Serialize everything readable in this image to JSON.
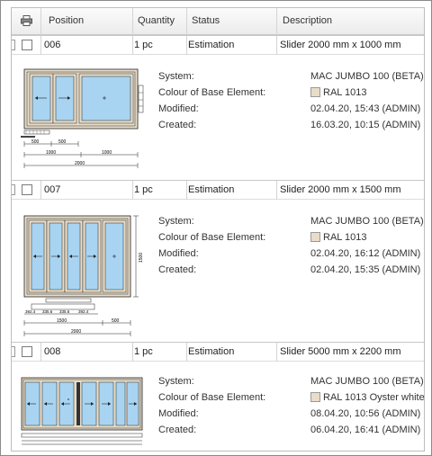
{
  "header": {
    "printer_icon": "printer-icon",
    "position": "Position",
    "quantity": "Quantity",
    "status": "Status",
    "description": "Description"
  },
  "labels": {
    "system": "System:",
    "colour": "Colour of Base Element:",
    "modified": "Modified:",
    "created": "Created:"
  },
  "items": [
    {
      "position": "006",
      "quantity": "1 pc",
      "status": "Estimation",
      "description": "Slider 2000 mm x 1000 mm",
      "system": "MAC JUMBO 100 (BETA)",
      "colour": "RAL 1013",
      "modified": "02.04.20, 15:43 (ADMIN)",
      "created": "16.03.20, 10:15 (ADMIN)",
      "dims": [
        "500",
        "500",
        "1000",
        "1000",
        "2000"
      ]
    },
    {
      "position": "007",
      "quantity": "1 pc",
      "status": "Estimation",
      "description": "Slider 2000 mm x 1500 mm",
      "system": "MAC JUMBO 100 (BETA)",
      "colour": "RAL 1013",
      "modified": "02.04.20, 16:12 (ADMIN)",
      "created": "02.04.20, 15:35 (ADMIN)",
      "dims": [
        "392.4",
        "335.6",
        "335.6",
        "392.4",
        "1500",
        "500",
        "2000",
        "1500"
      ]
    },
    {
      "position": "008",
      "quantity": "1 pc",
      "status": "Estimation",
      "description": "Slider 5000 mm x 2200 mm",
      "system": "MAC JUMBO 100 (BETA)",
      "colour": "RAL 1013 Oyster white",
      "modified": "08.04.20, 10:56 (ADMIN)",
      "created": "06.04.20, 16:41 (ADMIN)",
      "dims": []
    }
  ],
  "colors": {
    "frame": "#e8ddc9",
    "glass": "#a8d4f2",
    "line": "#222222"
  }
}
